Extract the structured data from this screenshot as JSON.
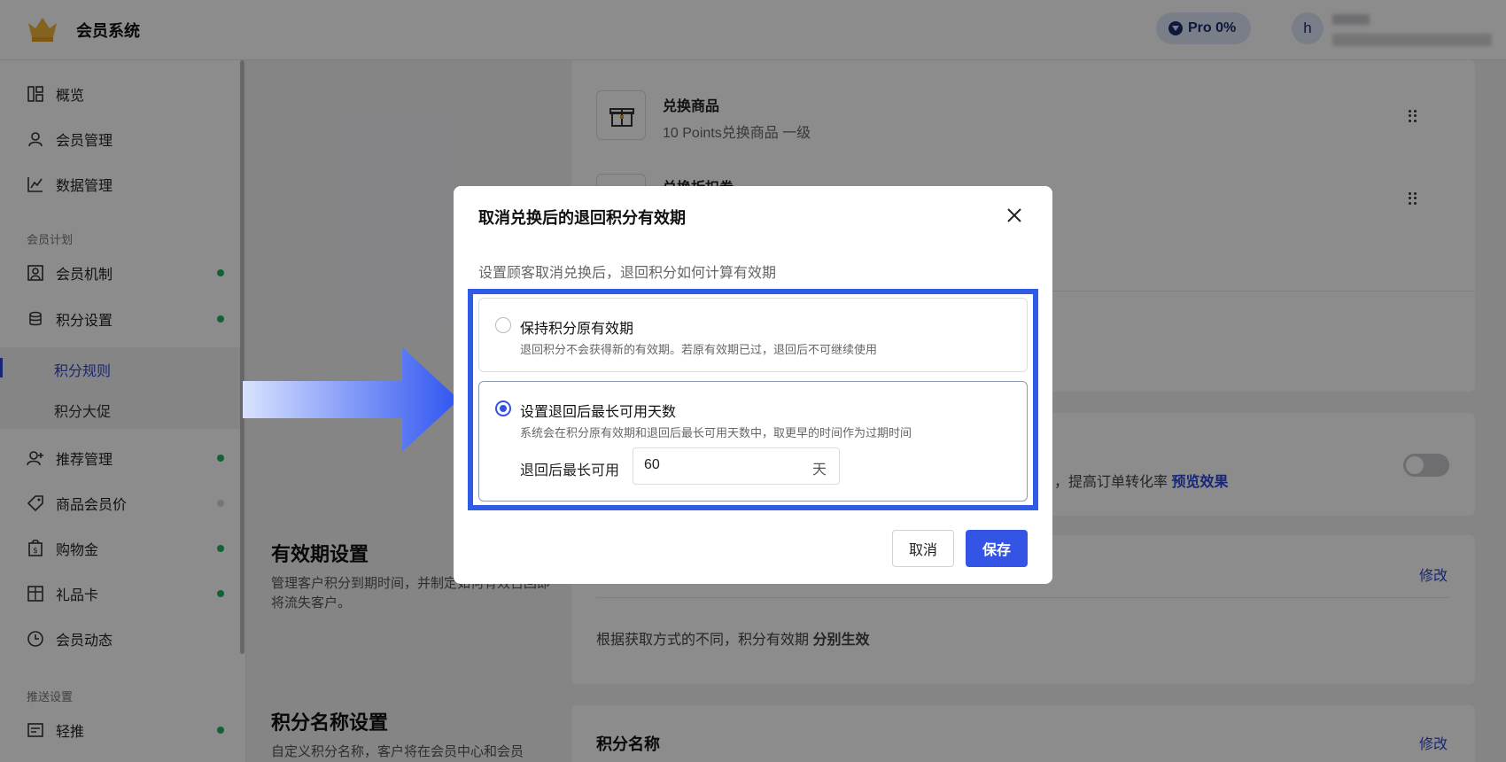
{
  "header": {
    "app_title": "会员系统",
    "pro_badge": "Pro 0%",
    "avatar_initial": "h"
  },
  "sidebar": {
    "items": [
      {
        "label": "概览",
        "icon": "overview-icon"
      },
      {
        "label": "会员管理",
        "icon": "user-icon"
      },
      {
        "label": "数据管理",
        "icon": "chart-icon"
      }
    ],
    "section_plan": "会员计划",
    "plan_items": [
      {
        "label": "会员机制",
        "icon": "member-card-icon",
        "status": "green"
      },
      {
        "label": "积分设置",
        "icon": "coins-icon",
        "status": "green"
      }
    ],
    "sub_items": [
      {
        "label": "积分规则",
        "active": true
      },
      {
        "label": "积分大促",
        "active": false
      }
    ],
    "more_items": [
      {
        "label": "推荐管理",
        "icon": "user-add-icon",
        "status": "green"
      },
      {
        "label": "商品会员价",
        "icon": "tag-icon",
        "status": "grey"
      },
      {
        "label": "购物金",
        "icon": "wallet-icon",
        "status": "green"
      },
      {
        "label": "礼品卡",
        "icon": "gift-card-icon",
        "status": "green"
      },
      {
        "label": "会员动态",
        "icon": "clock-icon",
        "status": "none"
      }
    ],
    "section_push": "推送设置",
    "push_items": [
      {
        "label": "轻推",
        "icon": "message-icon",
        "status": "green"
      }
    ]
  },
  "content": {
    "redeem_item_title": "兑换商品",
    "redeem_item_sub": "10 Points兑换商品 一级",
    "redeem_item2_title": "兑换折扣券",
    "conversion_text": "，提高订单转化率",
    "preview_link": "预览效果",
    "validity_title": "有效期设置",
    "validity_desc": "管理客户积分到期时间，并制定如何有效召回即将流失客户。",
    "validity_edit": "修改",
    "validity_rule_text": "根据获取方式的不同，积分有效期",
    "validity_rule_bold": "分别生效",
    "points_name_title": "积分名称设置",
    "points_name_desc": "自定义积分名称，客户将在会员中心和会员",
    "points_name_card_title": "积分名称",
    "points_name_edit": "修改"
  },
  "modal": {
    "title": "取消兑换后的退回积分有效期",
    "description": "设置顾客取消兑换后，退回积分如何计算有效期",
    "options": [
      {
        "title": "保持积分原有效期",
        "subtitle": "退回积分不会获得新的有效期。若原有效期已过，退回后不可继续使用",
        "selected": false
      },
      {
        "title": "设置退回后最长可用天数",
        "subtitle": "系统会在积分原有效期和退回后最长可用天数中，取更早的时间作为过期时间",
        "selected": true
      }
    ],
    "days_label": "退回后最长可用",
    "days_value": "60",
    "days_unit": "天",
    "cancel_label": "取消",
    "save_label": "保存"
  },
  "colors": {
    "accent": "#3454e6",
    "highlight": "#2f5be6",
    "status_green": "#23b35f"
  }
}
